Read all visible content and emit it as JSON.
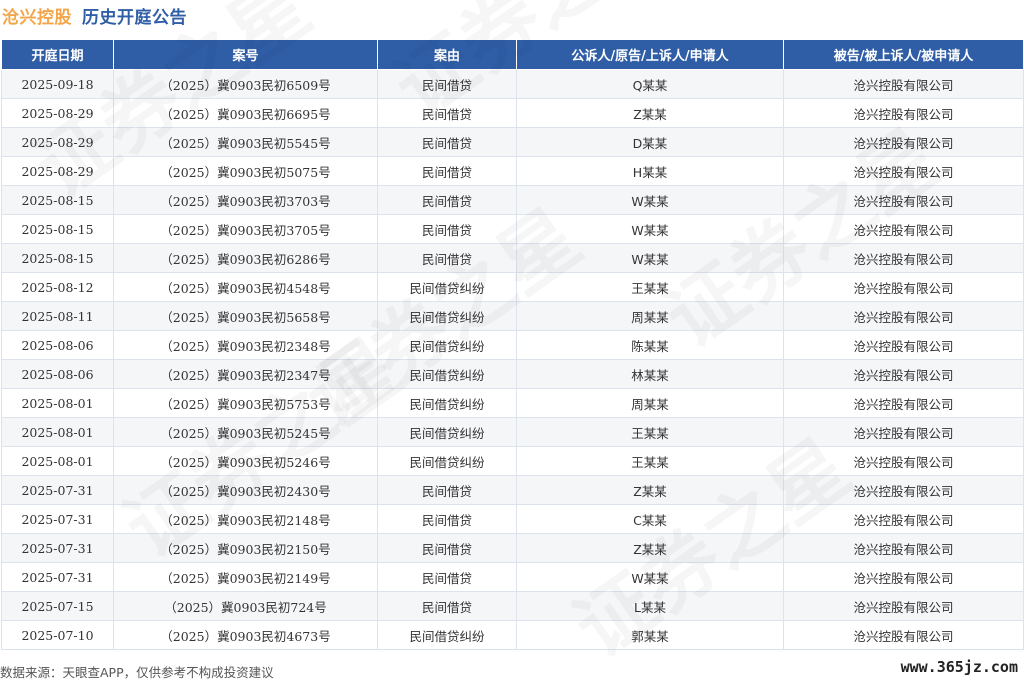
{
  "header": {
    "company": "沧兴控股",
    "title": "历史开庭公告"
  },
  "table": {
    "columns": [
      "开庭日期",
      "案号",
      "案由",
      "公诉人/原告/上诉人/申请人",
      "被告/被上诉人/被申请人"
    ],
    "rows": [
      {
        "date": "2025-09-18",
        "case": "（2025）冀0903民初6509号",
        "cause": "民间借贷",
        "plaintiff": "Q某某",
        "defendant": "沧兴控股有限公司"
      },
      {
        "date": "2025-08-29",
        "case": "（2025）冀0903民初6695号",
        "cause": "民间借贷",
        "plaintiff": "Z某某",
        "defendant": "沧兴控股有限公司"
      },
      {
        "date": "2025-08-29",
        "case": "（2025）冀0903民初5545号",
        "cause": "民间借贷",
        "plaintiff": "D某某",
        "defendant": "沧兴控股有限公司"
      },
      {
        "date": "2025-08-29",
        "case": "（2025）冀0903民初5075号",
        "cause": "民间借贷",
        "plaintiff": "H某某",
        "defendant": "沧兴控股有限公司"
      },
      {
        "date": "2025-08-15",
        "case": "（2025）冀0903民初3703号",
        "cause": "民间借贷",
        "plaintiff": "W某某",
        "defendant": "沧兴控股有限公司"
      },
      {
        "date": "2025-08-15",
        "case": "（2025）冀0903民初3705号",
        "cause": "民间借贷",
        "plaintiff": "W某某",
        "defendant": "沧兴控股有限公司"
      },
      {
        "date": "2025-08-15",
        "case": "（2025）冀0903民初6286号",
        "cause": "民间借贷",
        "plaintiff": "W某某",
        "defendant": "沧兴控股有限公司"
      },
      {
        "date": "2025-08-12",
        "case": "（2025）冀0903民初4548号",
        "cause": "民间借贷纠纷",
        "plaintiff": "王某某",
        "defendant": "沧兴控股有限公司"
      },
      {
        "date": "2025-08-11",
        "case": "（2025）冀0903民初5658号",
        "cause": "民间借贷纠纷",
        "plaintiff": "周某某",
        "defendant": "沧兴控股有限公司"
      },
      {
        "date": "2025-08-06",
        "case": "（2025）冀0903民初2348号",
        "cause": "民间借贷纠纷",
        "plaintiff": "陈某某",
        "defendant": "沧兴控股有限公司"
      },
      {
        "date": "2025-08-06",
        "case": "（2025）冀0903民初2347号",
        "cause": "民间借贷纠纷",
        "plaintiff": "林某某",
        "defendant": "沧兴控股有限公司"
      },
      {
        "date": "2025-08-01",
        "case": "（2025）冀0903民初5753号",
        "cause": "民间借贷纠纷",
        "plaintiff": "周某某",
        "defendant": "沧兴控股有限公司"
      },
      {
        "date": "2025-08-01",
        "case": "（2025）冀0903民初5245号",
        "cause": "民间借贷纠纷",
        "plaintiff": "王某某",
        "defendant": "沧兴控股有限公司"
      },
      {
        "date": "2025-08-01",
        "case": "（2025）冀0903民初5246号",
        "cause": "民间借贷纠纷",
        "plaintiff": "王某某",
        "defendant": "沧兴控股有限公司"
      },
      {
        "date": "2025-07-31",
        "case": "（2025）冀0903民初2430号",
        "cause": "民间借贷",
        "plaintiff": "Z某某",
        "defendant": "沧兴控股有限公司"
      },
      {
        "date": "2025-07-31",
        "case": "（2025）冀0903民初2148号",
        "cause": "民间借贷",
        "plaintiff": "C某某",
        "defendant": "沧兴控股有限公司"
      },
      {
        "date": "2025-07-31",
        "case": "（2025）冀0903民初2150号",
        "cause": "民间借贷",
        "plaintiff": "Z某某",
        "defendant": "沧兴控股有限公司"
      },
      {
        "date": "2025-07-31",
        "case": "（2025）冀0903民初2149号",
        "cause": "民间借贷",
        "plaintiff": "W某某",
        "defendant": "沧兴控股有限公司"
      },
      {
        "date": "2025-07-15",
        "case": "（2025）冀0903民初724号",
        "cause": "民间借贷",
        "plaintiff": "L某某",
        "defendant": "沧兴控股有限公司"
      },
      {
        "date": "2025-07-10",
        "case": "（2025）冀0903民初4673号",
        "cause": "民间借贷纠纷",
        "plaintiff": "郭某某",
        "defendant": "沧兴控股有限公司"
      }
    ]
  },
  "footer": {
    "source": "数据来源：天眼查APP，仅供参考不构成投资建议",
    "site": "www.365jz.com"
  },
  "watermark": {
    "text": "证券之星"
  },
  "colors": {
    "header_bg": "#2f5ea7",
    "company_title": "#f4a54a",
    "main_title": "#2f5ea7",
    "row_alt": "#f5f6f8"
  }
}
